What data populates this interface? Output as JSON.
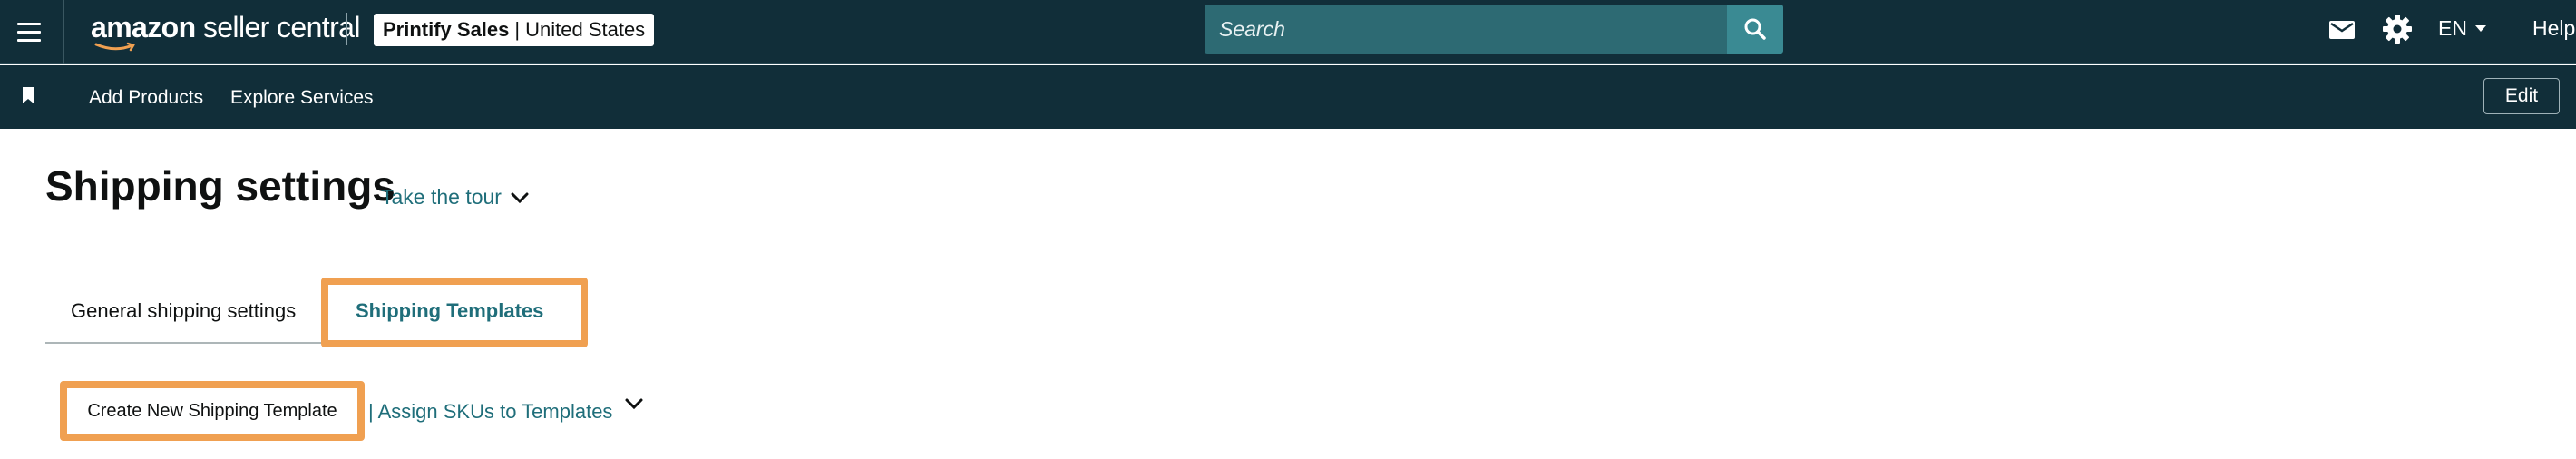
{
  "topbar": {
    "logo_bold": "amazon",
    "logo_rest": " seller central",
    "account_store": "Printify Sales",
    "account_separator": "|",
    "account_region": "United States",
    "search_placeholder": "Search",
    "language": "EN",
    "help": "Help",
    "icons": [
      "menu-icon",
      "search-icon",
      "mail-icon",
      "gear-icon",
      "chevron-down-icon"
    ]
  },
  "navbar": {
    "add_products": "Add Products",
    "explore_services": "Explore Services",
    "edit": "Edit"
  },
  "page": {
    "title": "Shipping settings",
    "tour": "Take the tour"
  },
  "tabs": [
    {
      "label": "General shipping settings",
      "active": false
    },
    {
      "label": "Shipping Templates",
      "active": true
    }
  ],
  "actions": {
    "create_template": "Create New Shipping Template",
    "assign_skus": "| Assign SKUs to Templates"
  },
  "colors": {
    "header_bg": "#112e39",
    "search_bg": "#2d6a73",
    "search_button": "#3a8a93",
    "link": "#1f6e7a",
    "highlight": "#f0a051"
  }
}
